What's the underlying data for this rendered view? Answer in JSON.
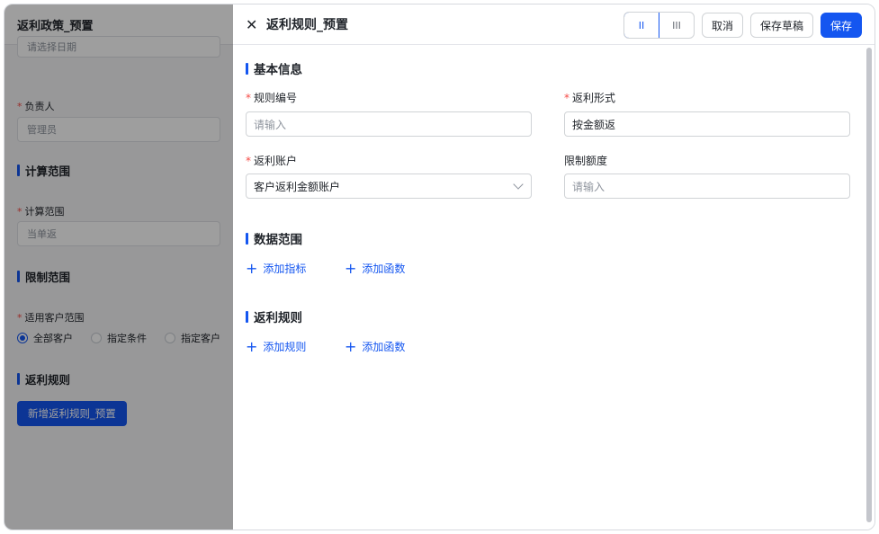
{
  "background_page": {
    "title": "返利政策_预置",
    "date_placeholder": "请选择日期",
    "owner_label": "负责人",
    "owner_value": "管理员",
    "calc_section": "计算范围",
    "calc_label": "计算范围",
    "calc_value": "当单返",
    "limit_section": "限制范围",
    "customer_scope_label": "适用客户范围",
    "radios": [
      "全部客户",
      "指定条件",
      "指定客户"
    ],
    "rebate_section": "返利规则",
    "add_rule_button": "新增返利规则_预置"
  },
  "drawer": {
    "title": "返利规则_预置",
    "view_options": [
      "II",
      "III"
    ],
    "cancel_label": "取消",
    "save_draft_label": "保存草稿",
    "save_label": "保存",
    "basic_info_title": "基本信息",
    "rule_no_label": "规则编号",
    "rule_no_placeholder": "请输入",
    "rebate_form_label": "返利形式",
    "rebate_form_value": "按金额返",
    "rebate_account_label": "返利账户",
    "rebate_account_value": "客户返利金额账户",
    "limit_amount_label": "限制额度",
    "limit_amount_placeholder": "请输入",
    "data_scope_title": "数据范围",
    "add_metric_label": "添加指标",
    "add_function_label": "添加函数",
    "rebate_rules_title": "返利规则",
    "add_rule_label": "添加规则",
    "add_function_label_2": "添加函数"
  },
  "colors": {
    "accent": "#1456f0",
    "required": "#f54a45"
  }
}
